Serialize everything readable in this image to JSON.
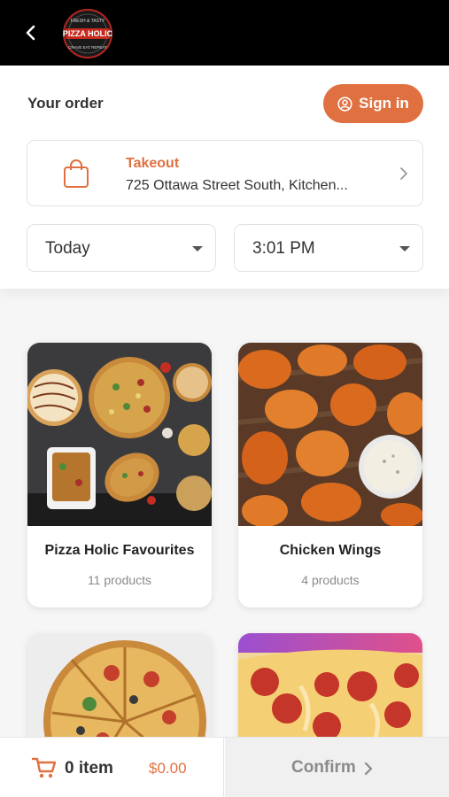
{
  "header": {
    "logo_icon": "pizza-holic-logo"
  },
  "order": {
    "title": "Your order",
    "sign_in_label": "Sign in",
    "mode_label": "Takeout",
    "address": "725 Ottawa Street South, Kitchen...",
    "day": "Today",
    "time": "3:01 PM"
  },
  "categories": [
    {
      "name": "Pizza Holic Favourites",
      "count": "11 products"
    },
    {
      "name": "Chicken Wings",
      "count": "4 products"
    }
  ],
  "cart": {
    "items_label": "0 item",
    "total": "$0.00",
    "confirm_label": "Confirm"
  },
  "colors": {
    "accent": "#e07040",
    "topbar": "#000000"
  }
}
